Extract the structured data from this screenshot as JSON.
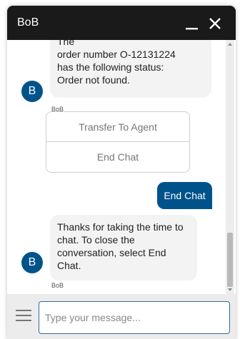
{
  "header": {
    "title": "BoB",
    "minimize_icon": "minimize-icon",
    "close_icon": "close-icon"
  },
  "messages": {
    "bot1": {
      "lines": [
        "The",
        "order number O-12131224",
        "has the following status:",
        "Order not found."
      ],
      "avatar": "B",
      "sender": "BoB"
    },
    "options": [
      "Transfer To Agent",
      "End Chat"
    ],
    "user1": "End Chat",
    "bot2": {
      "lines": [
        "Thanks for taking the time to",
        "chat. To close the",
        "conversation, select End",
        "Chat."
      ],
      "avatar": "B",
      "sender": "BoB"
    }
  },
  "footer": {
    "menu_icon": "hamburger-menu-icon",
    "placeholder": "Type your message..."
  },
  "colors": {
    "header_bg": "#1a1a1a",
    "accent": "#00538a",
    "bubble_bg": "#f3f3f3",
    "footer_bg": "#ececec"
  }
}
